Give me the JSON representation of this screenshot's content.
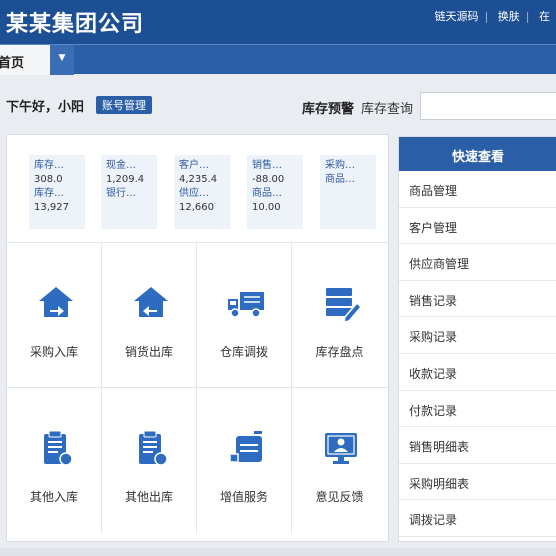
{
  "header": {
    "brand": "某某集团公司",
    "links": [
      "链天源码",
      "换肤",
      "在"
    ]
  },
  "tabs": {
    "home": "首页"
  },
  "topbar": {
    "greeting": "下午好，小阳",
    "account_btn": "账号管理",
    "stock_warning": "库存预警",
    "stock_query": "库存查询"
  },
  "stats": [
    {
      "l1": "库存…",
      "v1": "308.0",
      "l2": "库存…",
      "v2": "13,927"
    },
    {
      "l1": "现金…",
      "v1": "1,209.4",
      "l2": "银行…",
      "v2": ""
    },
    {
      "l1": "客户…",
      "v1": "4,235.4",
      "l2": "供应…",
      "v2": "12,660"
    },
    {
      "l1": "销售…",
      "v1": "-88.00",
      "l2": "商品…",
      "v2": "10.00"
    },
    {
      "l1": "采购…",
      "v1": "",
      "l2": "商品…",
      "v2": ""
    }
  ],
  "tiles": [
    "采购入库",
    "销货出库",
    "仓库调拨",
    "库存盘点",
    "其他入库",
    "其他出库",
    "增值服务",
    "意见反馈"
  ],
  "tile_icons": [
    "house-in-icon",
    "house-out-icon",
    "truck-icon",
    "stack-edit-icon",
    "clipboard-in-icon",
    "clipboard-out-icon",
    "cart-box-icon",
    "monitor-user-icon"
  ],
  "quick": {
    "title": "快速查看",
    "items": [
      "商品管理",
      "客户管理",
      "供应商管理",
      "销售记录",
      "采购记录",
      "收款记录",
      "付款记录",
      "销售明细表",
      "采购明细表",
      "调拨记录"
    ]
  },
  "colors": {
    "primary": "#2a5ea7",
    "header": "#1d4f95",
    "icon": "#2d6cc0"
  }
}
